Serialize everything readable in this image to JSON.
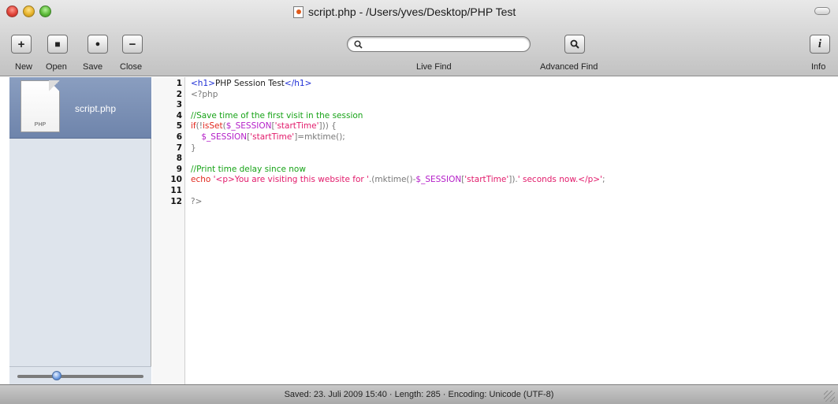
{
  "window": {
    "title": "script.php - /Users/yves/Desktop/PHP Test"
  },
  "toolbar": {
    "buttons": [
      {
        "label": "New",
        "icon": "+"
      },
      {
        "label": "Open",
        "icon": "■"
      },
      {
        "label": "Save",
        "icon": "●"
      },
      {
        "label": "Close",
        "icon": "−"
      }
    ],
    "live_find_label": "Live Find",
    "search_icon": "search-icon",
    "search_value": "",
    "advanced_find_label": "Advanced Find",
    "info_label": "Info",
    "info_icon": "i"
  },
  "sidebar": {
    "file_name": "script.php",
    "file_type": "PHP",
    "selected_color": "#6e84ab"
  },
  "editor": {
    "lines": [
      {
        "n": "1",
        "html": "<span class=\"c-tag\">&lt;h1&gt;</span><span class=\"c-text\">PHP Session Test</span><span class=\"c-tag\">&lt;/h1&gt;</span>"
      },
      {
        "n": "2",
        "html": "<span class=\"c-gray\">&lt;?php</span>"
      },
      {
        "n": "3",
        "html": ""
      },
      {
        "n": "4",
        "html": "<span class=\"c-comment\">//Save time of the first visit in the session</span>"
      },
      {
        "n": "5",
        "html": "<span class=\"c-kw\">if</span><span class=\"c-gray\">(!</span><span class=\"c-kw\">isSet</span><span class=\"c-gray\">(</span><span class=\"c-var\">$_SESSION</span><span class=\"c-gray\">[</span><span class=\"c-str\">'startTime'</span><span class=\"c-gray\">])) {</span>"
      },
      {
        "n": "6",
        "html": "    <span class=\"c-var\">$_SESSION</span><span class=\"c-gray\">[</span><span class=\"c-str\">'startTime'</span><span class=\"c-gray\">]=mktime();</span>"
      },
      {
        "n": "7",
        "html": "<span class=\"c-gray\">}</span>"
      },
      {
        "n": "8",
        "html": ""
      },
      {
        "n": "9",
        "html": "<span class=\"c-comment\">//Print time delay since now</span>"
      },
      {
        "n": "10",
        "html": "<span class=\"c-kw\">echo</span> <span class=\"c-str\">'&lt;p&gt;You are visiting this website for '</span><span class=\"c-gray\">.(mktime()-</span><span class=\"c-var\">$_SESSION</span><span class=\"c-gray\">[</span><span class=\"c-str\">'startTime'</span><span class=\"c-gray\">]).</span><span class=\"c-str\">' seconds now.&lt;/p&gt;'</span><span class=\"c-gray\">;</span>"
      },
      {
        "n": "11",
        "html": ""
      },
      {
        "n": "12",
        "html": "<span class=\"c-gray\">?&gt;</span>"
      }
    ]
  },
  "statusbar": {
    "text": "Saved: 23. Juli 2009 15:40  ·  Length: 285  ·  Encoding: Unicode (UTF-8)"
  }
}
